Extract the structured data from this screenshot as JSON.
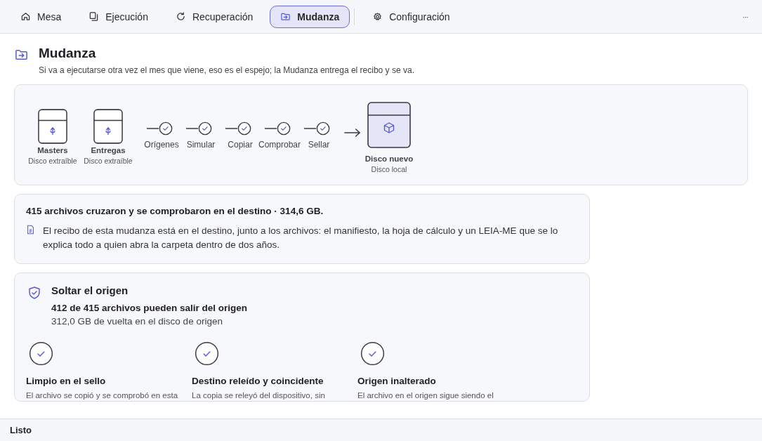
{
  "tabs": [
    {
      "label": "Mesa",
      "selected": false
    },
    {
      "label": "Ejecución",
      "selected": false
    },
    {
      "label": "Recuperación",
      "selected": false
    },
    {
      "label": "Mudanza",
      "selected": true
    },
    {
      "label": "Configuración",
      "selected": false
    }
  ],
  "more_menu": "···",
  "header": {
    "title": "Mudanza",
    "subtitle": "Si va a ejecutarse otra vez el mes que viene, eso es el espejo; la Mudanza entrega el recibo y se va."
  },
  "flow": {
    "sources": [
      {
        "name": "Masters",
        "type": "Disco extraíble"
      },
      {
        "name": "Entregas",
        "type": "Disco extraíble"
      }
    ],
    "steps": [
      {
        "label": "Orígenes",
        "done": true
      },
      {
        "label": "Simular",
        "done": true
      },
      {
        "label": "Copiar",
        "done": true
      },
      {
        "label": "Comprobar",
        "done": true
      },
      {
        "label": "Sellar",
        "done": true
      }
    ],
    "destination": {
      "name": "Disco nuevo",
      "type": "Disco local"
    }
  },
  "summary": {
    "headline": "415 archivos cruzaron y se comprobaron en el destino · 314,6 GB.",
    "note": "El recibo de esta mudanza está en el destino, junto a los archivos: el manifiesto, la hoja de cálculo y un LEIA-ME que se lo explica todo a quien abra la carpeta dentro de dos años."
  },
  "release": {
    "title": "Soltar el origen",
    "count": "412 de 415 archivos pueden salir del origen",
    "space": "312,0 GB de vuelta en el disco de origen",
    "checks": [
      {
        "title": "Limpio en el sello",
        "text": "El archivo se copió y se comprobó en esta",
        "passed": true
      },
      {
        "title": "Destino releído y coincidente",
        "text": "La copia se releyó del dispositivo, sin",
        "passed": true
      },
      {
        "title": "Origen inalterado",
        "text": "El archivo en el origen sigue siendo el",
        "passed": true
      }
    ]
  },
  "status_bar": "Listo"
}
